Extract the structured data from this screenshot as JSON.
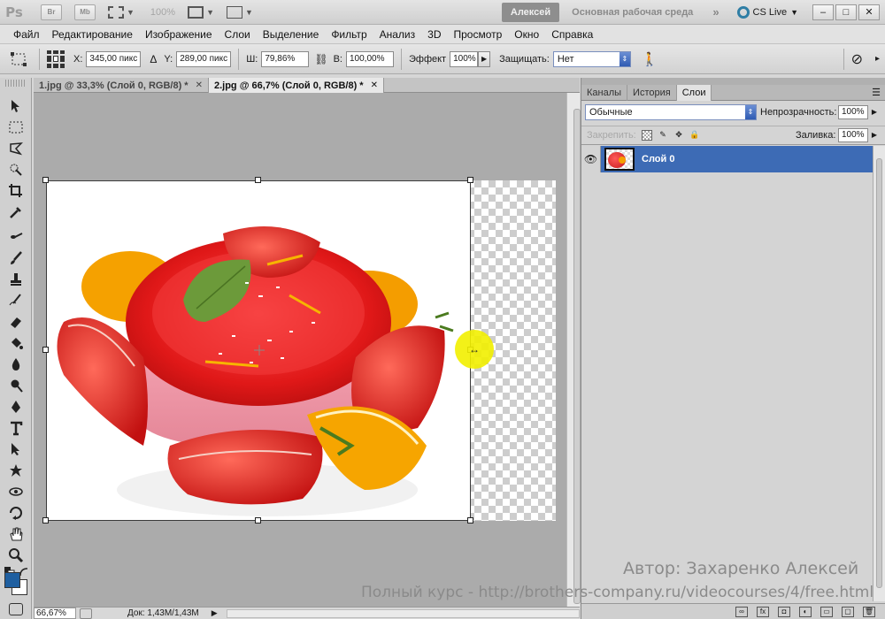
{
  "appbar": {
    "logo": "Ps",
    "bridge_label": "Br",
    "minibridge_label": "Mb",
    "zoom": "100%",
    "user": "Алексей",
    "workspace": "Основная рабочая среда",
    "cs_live": "CS Live"
  },
  "menu": [
    "Файл",
    "Редактирование",
    "Изображение",
    "Слои",
    "Выделение",
    "Фильтр",
    "Анализ",
    "3D",
    "Просмотр",
    "Окно",
    "Справка"
  ],
  "options": {
    "x_label": "X:",
    "x_value": "345,00 пикс",
    "y_label": "Y:",
    "y_value": "289,00 пикс",
    "w_label": "Ш:",
    "w_value": "79,86%",
    "h_label": "В:",
    "h_value": "100,00%",
    "effect_label": "Эффект",
    "effect_value": "100%",
    "protect_label": "Защищать:",
    "protect_value": "Нет"
  },
  "tabs": [
    {
      "label": "1.jpg @ 33,3% (Слой 0, RGB/8) *",
      "active": false
    },
    {
      "label": "2.jpg @ 66,7% (Слой 0, RGB/8) *",
      "active": true
    }
  ],
  "status": {
    "zoom": "66,67%",
    "doc": "Док: 1,43M/1,43M"
  },
  "panels": {
    "tabs": [
      "Каналы",
      "История",
      "Слои"
    ],
    "blend_mode": "Обычные",
    "opacity_label": "Непрозрачность:",
    "opacity_value": "100%",
    "lock_label": "Закрепить:",
    "fill_label": "Заливка:",
    "fill_value": "100%",
    "layer_name": "Слой 0"
  },
  "watermark": {
    "author": "Автор: Захаренко Алексей",
    "course": "Полный курс - http://brothers-company.ru/videocourses/4/free.html"
  },
  "colors": {
    "foreground": "#1f5fa0",
    "background": "#ffffff",
    "layer_selected": "#3d6bb5"
  }
}
